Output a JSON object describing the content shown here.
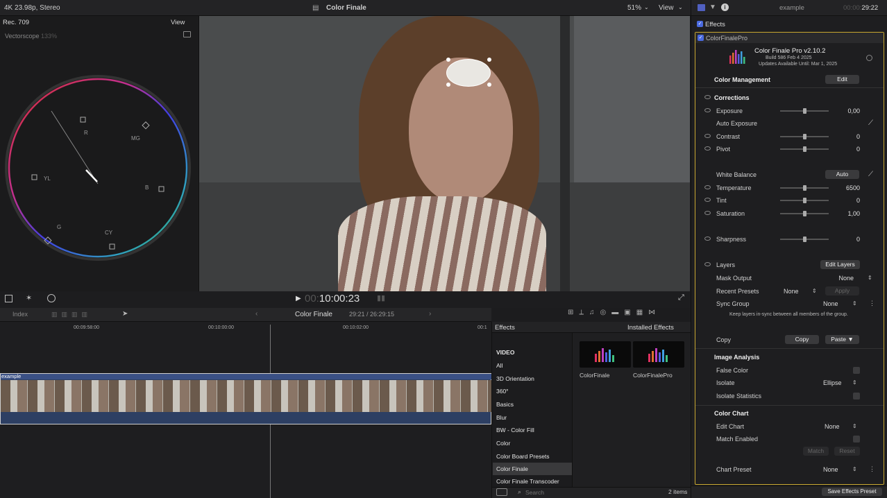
{
  "topbar": {
    "format": "4K 23.98p, Stereo",
    "title": "Color Finale",
    "zoom": "51%",
    "view": "View"
  },
  "scope": {
    "colorspace": "Rec. 709",
    "view": "View",
    "name": "Vectorscope",
    "percent": "133%",
    "targets": [
      "R",
      "MG",
      "B",
      "CY",
      "G",
      "YL"
    ]
  },
  "viewer": {
    "timecode_prefix": "00:",
    "timecode": "10:00:23"
  },
  "timeline": {
    "index": "Index",
    "project": "Color Finale",
    "duration": "29:21 / 26:29:15",
    "ruler": [
      "00:09:58:00",
      "00:10:00:00",
      "00:10:02:00",
      "00:1"
    ],
    "clip_name": "example"
  },
  "effects_browser": {
    "title": "Effects",
    "installed": "Installed Effects",
    "categories": [
      "VIDEO",
      "All",
      "3D Orientation",
      "360°",
      "Basics",
      "Blur",
      "BW - Color Fill",
      "Color",
      "Color Board Presets",
      "Color Finale",
      "Color Finale Transcoder"
    ],
    "selected": "Color Finale",
    "items": [
      "ColorFinale",
      "ColorFinalePro"
    ],
    "search_placeholder": "Search",
    "count": "2 items"
  },
  "inspector": {
    "clip": "example",
    "time_dim": "00:00:",
    "time": "29:22",
    "effects_label": "Effects",
    "plugin_label": "ColorFinalePro",
    "plugin_title": "Color Finale Pro v2.10.2",
    "build": "Build 586 Feb  4 2025",
    "updates": "Updates Available Until: Mar 1, 2025",
    "color_management": "Color Management",
    "edit": "Edit",
    "corrections": "Corrections",
    "exposure": "Exposure",
    "exposure_val": "0,00",
    "auto_exposure": "Auto Exposure",
    "contrast": "Contrast",
    "contrast_val": "0",
    "pivot": "Pivot",
    "pivot_val": "0",
    "white_balance": "White Balance",
    "auto": "Auto",
    "temperature": "Temperature",
    "temperature_val": "6500",
    "tint": "Tint",
    "tint_val": "0",
    "saturation": "Saturation",
    "saturation_val": "1,00",
    "sharpness": "Sharpness",
    "sharpness_val": "0",
    "layers": "Layers",
    "edit_layers": "Edit Layers",
    "mask_output": "Mask Output",
    "mask_output_val": "None",
    "recent_presets": "Recent Presets",
    "recent_presets_val": "None",
    "apply": "Apply",
    "sync_group": "Sync Group",
    "sync_group_val": "None",
    "sync_note": "Keep layers in-sync between all members of the group.",
    "copy": "Copy",
    "copy_btn": "Copy",
    "paste_btn": "Paste",
    "image_analysis": "Image Analysis",
    "false_color": "False Color",
    "isolate": "Isolate",
    "isolate_val": "Ellipse",
    "isolate_stats": "Isolate Statistics",
    "color_chart": "Color Chart",
    "edit_chart": "Edit Chart",
    "edit_chart_val": "None",
    "match_enabled": "Match Enabled",
    "match": "Match",
    "reset": "Reset",
    "chart_preset": "Chart Preset",
    "chart_preset_val": "None",
    "save_preset": "Save Effects Preset"
  }
}
